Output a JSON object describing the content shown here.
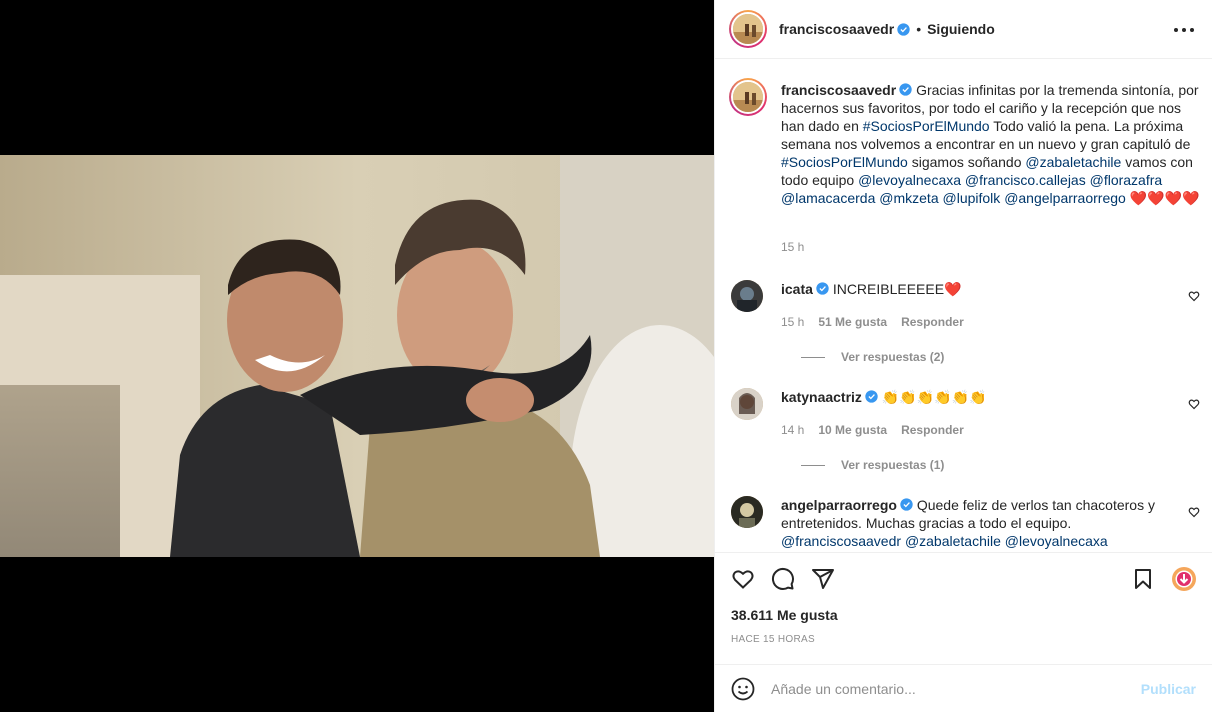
{
  "post": {
    "author": "franciscosaavedr",
    "separator": "•",
    "follow_status": "Siguiendo"
  },
  "caption": {
    "author": "franciscosaavedr",
    "text_1": "Gracias infinitas por la tremenda sintonía, por hacernos sus favoritos, por todo el cariño y la recepción que nos han dado en",
    "hashtag_1": "#SociosPorElMundo",
    "text_2": "Todo valió la pena. La próxima semana nos volvemos a encontrar en un nuevo y gran capituló de",
    "hashtag_2": "#SociosPorElMundo",
    "text_3": "sigamos soñando",
    "mentions": [
      "@zabaletachile",
      "@levoyalnecaxa",
      "@francisco.callejas",
      "@florazafra",
      "@lamacacerda",
      "@mkzeta",
      "@lupifolk",
      "@angelparraorrego"
    ],
    "text_4": "vamos con todo equipo",
    "emojis": "❤️❤️❤️❤️",
    "time": "15 h"
  },
  "comments": [
    {
      "user": "icata",
      "text": "INCREIBLEEEEE❤️",
      "time": "15 h",
      "likes": "51 Me gusta",
      "reply": "Responder",
      "view_replies": "Ver respuestas (2)"
    },
    {
      "user": "katynaactriz",
      "text": "👏👏👏👏👏👏",
      "time": "14 h",
      "likes": "10 Me gusta",
      "reply": "Responder",
      "view_replies": "Ver respuestas (1)"
    },
    {
      "user": "angelparraorrego",
      "text": "Quede feliz de verlos tan chacoteros y entretenidos. Muchas gracias a todo el equipo.",
      "mentions": [
        "@franciscosaavedr",
        "@zabaletachile",
        "@levoyalnecaxa"
      ]
    }
  ],
  "stats": {
    "likes": "38.611 Me gusta",
    "ago": "HACE 15 HORAS"
  },
  "composer": {
    "placeholder": "Añade un comentario...",
    "publish": "Publicar"
  },
  "icons": {
    "verified": "verified-badge-icon",
    "more": "more-options-icon",
    "like": "heart-icon",
    "comment": "comment-icon",
    "share": "send-icon",
    "save": "bookmark-icon",
    "download": "download-icon",
    "emoji": "emoji-icon"
  },
  "colors": {
    "link": "#00376b",
    "verified": "#3897f0",
    "muted": "#8e8e8e",
    "publish_disabled": "#b2dffc"
  }
}
